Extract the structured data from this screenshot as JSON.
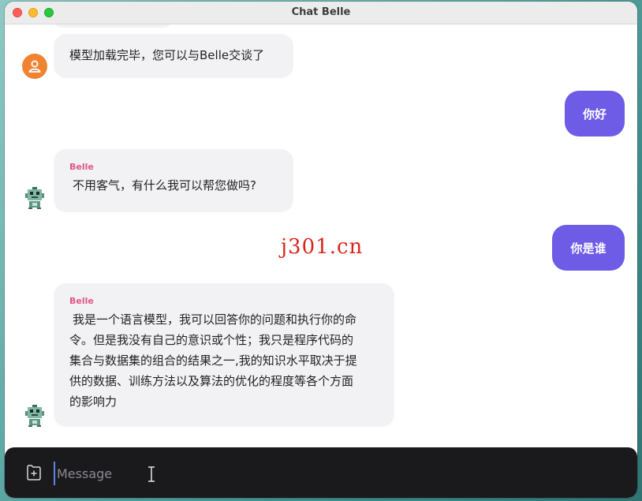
{
  "window": {
    "title": "Chat Belle"
  },
  "messages": [
    {
      "role": "bot",
      "avatar": "user-avatar-icon",
      "text": "模型加载完毕，您可以与Belle交谈了"
    },
    {
      "role": "user",
      "text": "你好"
    },
    {
      "role": "bot",
      "name": "Belle",
      "avatar": "robot-avatar-icon",
      "text": "不用客气，有什么我可以帮您做吗?"
    },
    {
      "role": "user",
      "text": "你是谁"
    },
    {
      "role": "bot",
      "name": "Belle",
      "avatar": "robot-avatar-icon",
      "lines": [
        "我是一个语言模型，我可以回答你的问题和执行你的命",
        "令。但是我没有自己的意识或个性；我只是程序代码的",
        "集合与数据集的组合的结果之一,我的知识水平取决于提",
        "供的数据、训练方法以及算法的优化的程度等各个方面",
        "的影响力"
      ]
    }
  ],
  "watermark": "j301.cn",
  "composer": {
    "placeholder": "Message",
    "value": ""
  },
  "colors": {
    "accent": "#6e5be6",
    "bot_name": "#e0568a",
    "bubble_bg": "#f2f2f4",
    "composer_bg": "#1a1a1d"
  }
}
